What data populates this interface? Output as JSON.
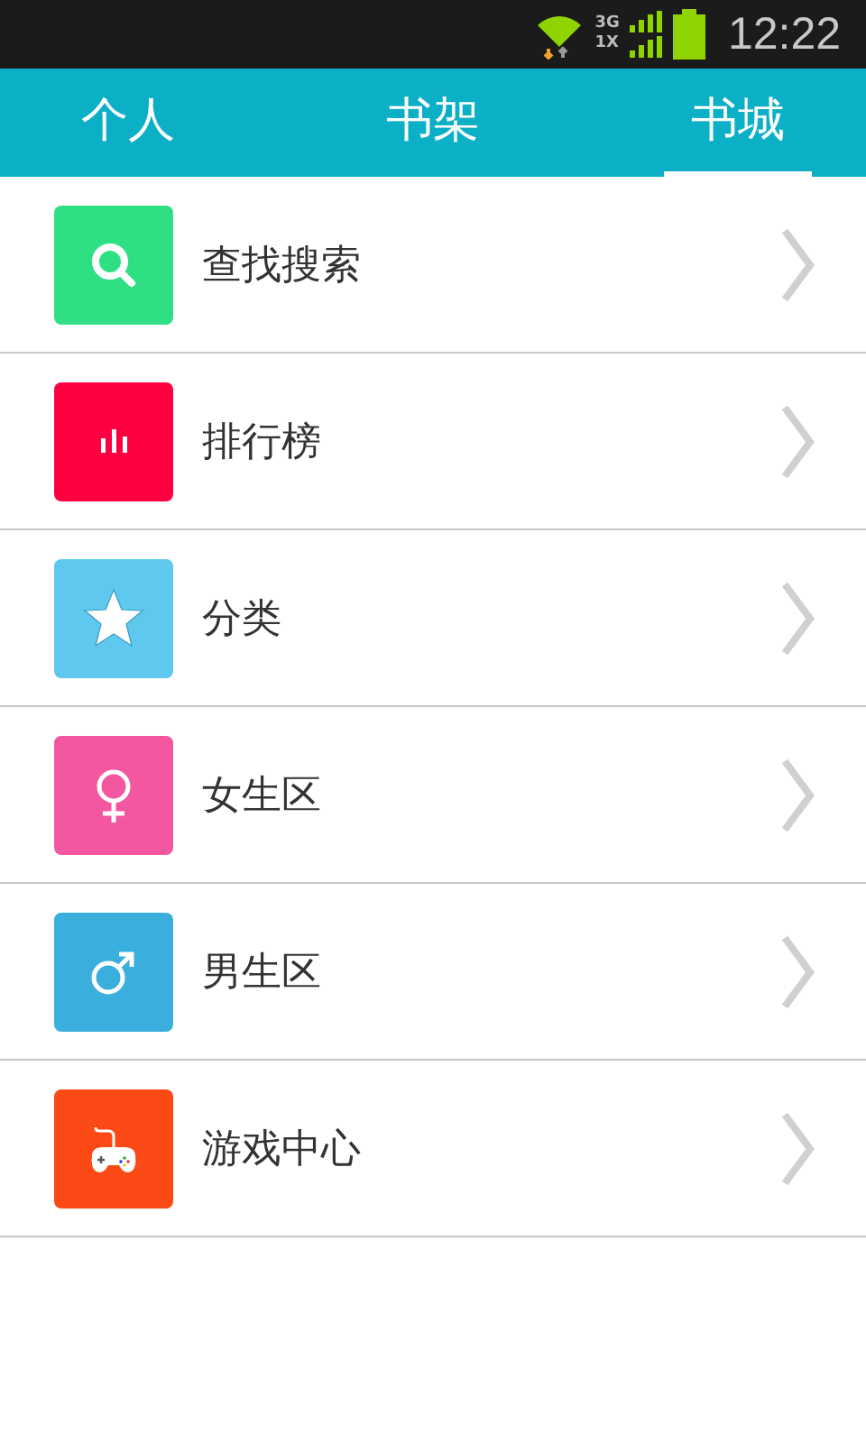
{
  "status_bar": {
    "network_top": "3G",
    "network_bottom": "1X",
    "time": "12:22"
  },
  "tabs": [
    {
      "label": "个人",
      "selected": false
    },
    {
      "label": "书架",
      "selected": false
    },
    {
      "label": "书城",
      "selected": true
    }
  ],
  "menu": [
    {
      "label": "查找搜索",
      "kind": "search",
      "color": "#2fdf84"
    },
    {
      "label": "排行榜",
      "kind": "chart",
      "color": "#fe0041"
    },
    {
      "label": "分类",
      "kind": "star",
      "color": "#5ec8ee"
    },
    {
      "label": "女生区",
      "kind": "female",
      "color": "#f2579f"
    },
    {
      "label": "男生区",
      "kind": "male",
      "color": "#3aaedc"
    },
    {
      "label": "游戏中心",
      "kind": "game",
      "color": "#fb4a16"
    }
  ]
}
